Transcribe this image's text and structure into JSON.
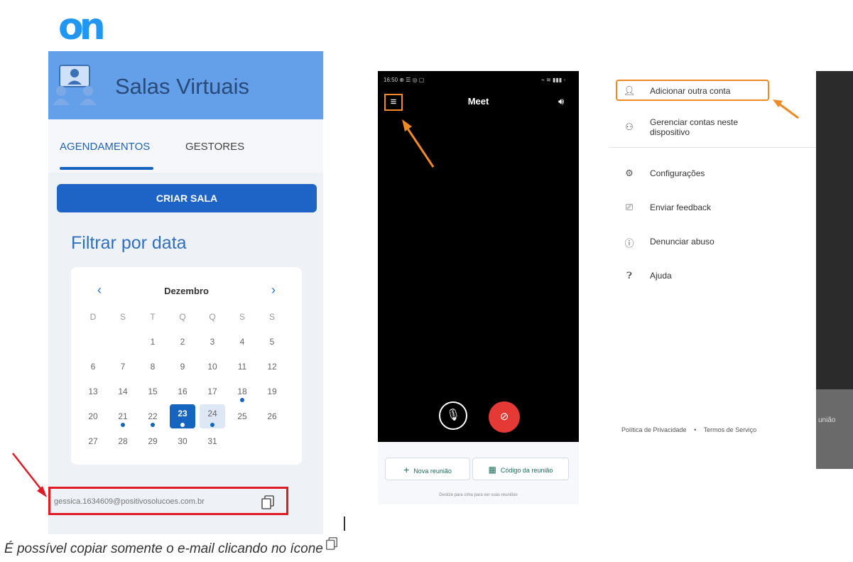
{
  "logo": {
    "text": "on"
  },
  "salas": {
    "title": "Salas Virtuais",
    "header_icon": "video-conference-icon",
    "tabs": [
      {
        "label": "AGENDAMENTOS",
        "active": true
      },
      {
        "label": "GESTORES",
        "active": false
      }
    ],
    "create_button": "CRIAR SALA",
    "filter_title": "Filtrar por data",
    "calendar": {
      "month": "Dezembro",
      "prev": "‹",
      "next": "›",
      "weekdays": [
        "D",
        "S",
        "T",
        "Q",
        "Q",
        "S",
        "S"
      ],
      "weeks": [
        [
          "",
          "",
          "1",
          "2",
          "3",
          "4",
          "5"
        ],
        [
          "6",
          "7",
          "8",
          "9",
          "10",
          "11",
          "12"
        ],
        [
          "13",
          "14",
          "15",
          "16",
          "17",
          "18",
          "19"
        ],
        [
          "20",
          "21",
          "22",
          "23",
          "24",
          "25",
          "26"
        ],
        [
          "27",
          "28",
          "29",
          "30",
          "31",
          "",
          ""
        ]
      ],
      "selected_day": "23",
      "highlighted_day": "24",
      "days_with_events": [
        "18",
        "21",
        "22",
        "23",
        "24"
      ]
    },
    "email": "gessica.1634609@positivosolucoes.com.br",
    "copy_icon": "copy-icon"
  },
  "phone": {
    "status_left": "16:50 ⊕ ☰ ◎ ▢",
    "status_right": "⌁ ≋ ▮▮▮ ◦",
    "title": "Meet",
    "menu_icon": "≡",
    "speaker_icon": "🔊︎",
    "mic_icon": "🎙︎",
    "camera_off_icon": "⊘",
    "new_meeting_label": "Nova reunião",
    "new_meeting_icon": "+",
    "meeting_code_label": "Código da reunião",
    "meeting_code_icon": "▦",
    "swipe_hint": "Deslize para cima para ver suas reuniões"
  },
  "menu": {
    "items": [
      {
        "icon": "👤︎",
        "label": "Adicionar outra conta"
      },
      {
        "icon": "⚇",
        "label": "Gerenciar contas neste dispositivo"
      },
      {
        "icon": "⚙",
        "label": "Configurações"
      },
      {
        "icon": "⎚",
        "label": "Enviar feedback"
      },
      {
        "icon": "ⓘ",
        "label": "Denunciar abuso"
      },
      {
        "icon": "❓︎",
        "label": "Ajuda"
      }
    ],
    "privacy": "Política de Privacidade",
    "separator": "•",
    "terms": "Termos de Serviço",
    "right_fragment": "união"
  },
  "caption": {
    "text": "É possível copiar somente o e-mail clicando no ícone"
  },
  "colors": {
    "brand_blue": "#1565c0",
    "header_blue": "#64a0ea",
    "highlight_orange": "#f08a24",
    "highlight_red": "#e01b24",
    "camera_red": "#e53935"
  }
}
